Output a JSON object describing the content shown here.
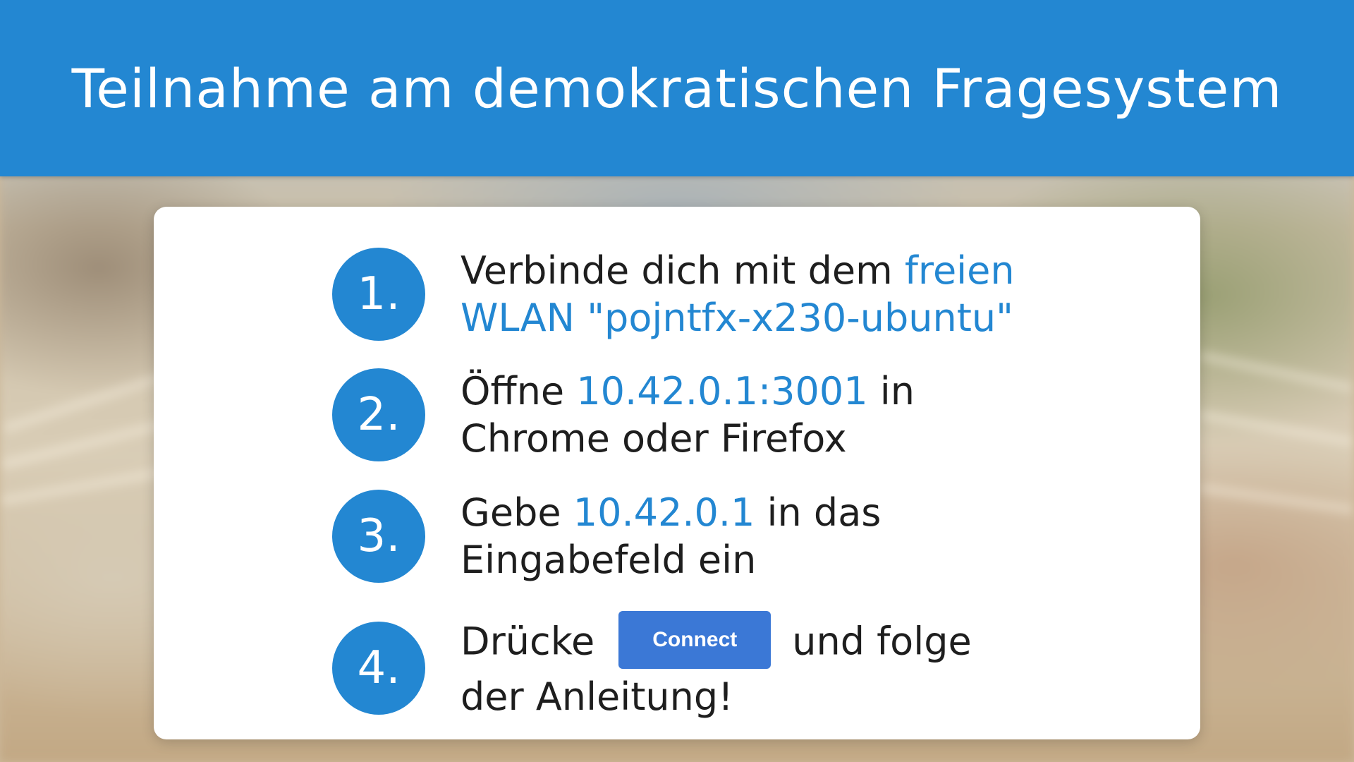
{
  "header": {
    "title": "Teilnahme am demokratischen Fragesystem"
  },
  "steps": [
    {
      "number": "1.",
      "line1_before": "Verbinde dich mit dem ",
      "line1_highlight": "freien",
      "line2_highlight": "WLAN \"pojntfx-x230-ubuntu\""
    },
    {
      "number": "2.",
      "line1_before": "Öffne ",
      "line1_highlight": "10.42.0.1:3001",
      "line1_after": " in",
      "line2": "Chrome oder Firefox"
    },
    {
      "number": "3.",
      "line1_before": "Gebe ",
      "line1_highlight": "10.42.0.1",
      "line1_after": " in das",
      "line2": "Eingabefeld ein"
    },
    {
      "number": "4.",
      "line1_before": "Drücke",
      "button_label": "Connect",
      "line1_after": "und folge",
      "line2": "der Anleitung!"
    }
  ],
  "colors": {
    "accent": "#2387d2",
    "button": "#3b78d6",
    "text": "#1e1e1e"
  }
}
